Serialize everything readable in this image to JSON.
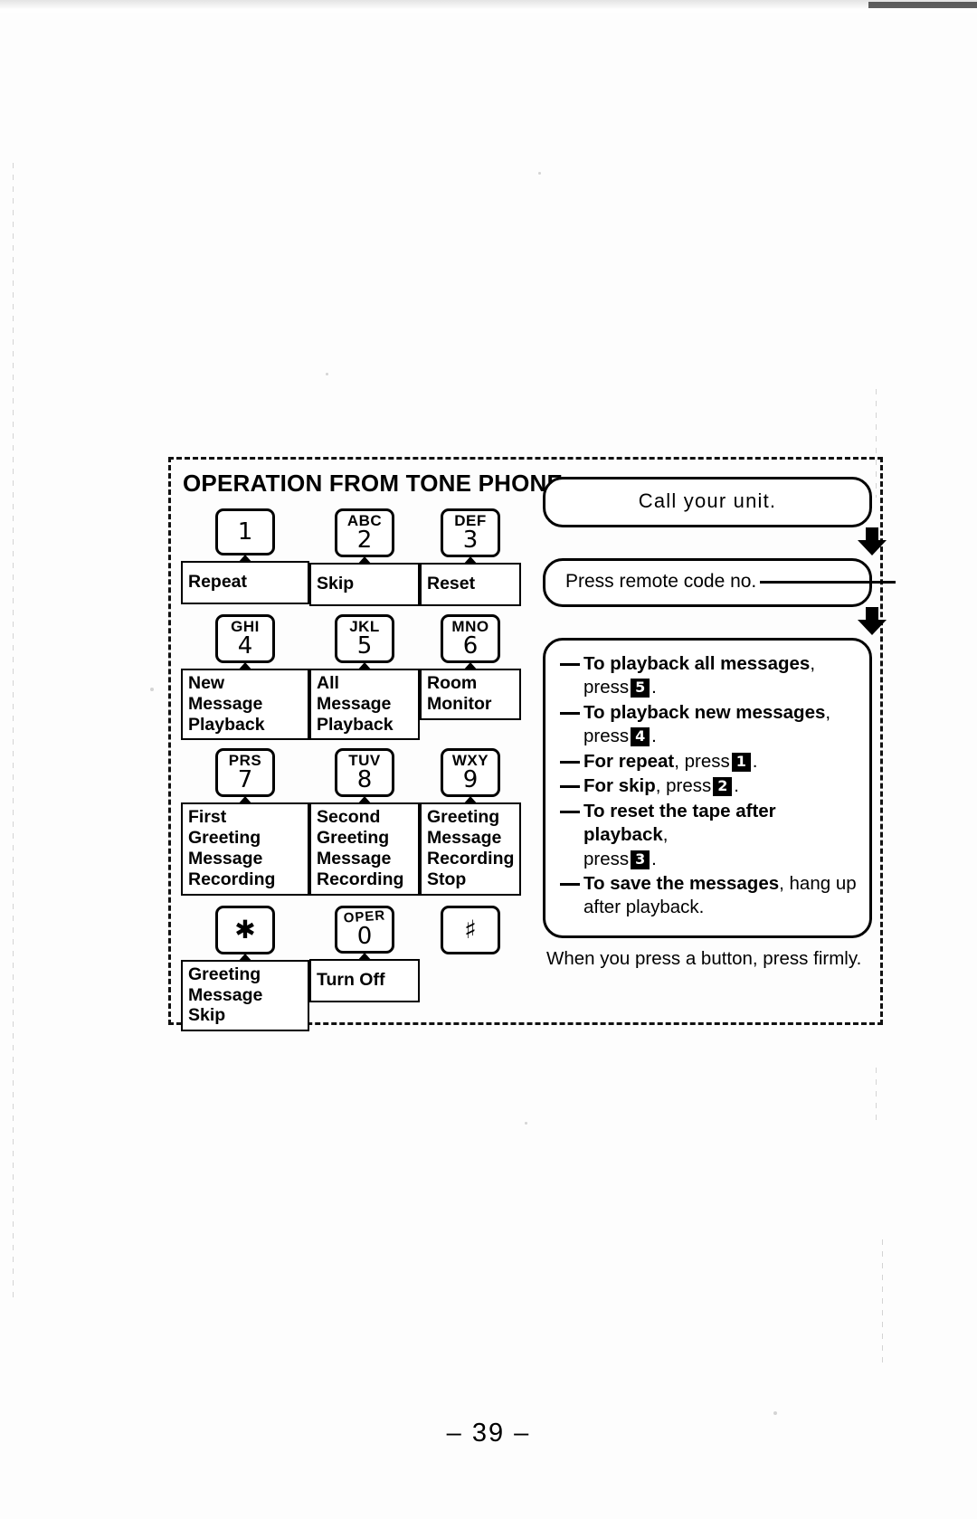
{
  "section": {
    "title": "OPERATION FROM TONE PHONE"
  },
  "keypad": {
    "rows": [
      [
        {
          "letters": "",
          "digit": "1",
          "label": "Repeat"
        },
        {
          "letters": "ABC",
          "digit": "2",
          "label": "Skip"
        },
        {
          "letters": "DEF",
          "digit": "3",
          "label": "Reset"
        }
      ],
      [
        {
          "letters": "GHI",
          "digit": "4",
          "label": "New Message\nPlayback"
        },
        {
          "letters": "JKL",
          "digit": "5",
          "label": "All Message\nPlayback"
        },
        {
          "letters": "MNO",
          "digit": "6",
          "label": "Room\nMonitor"
        }
      ],
      [
        {
          "letters": "PRS",
          "digit": "7",
          "label": "First\nGreeting\nMessage\nRecording"
        },
        {
          "letters": "TUV",
          "digit": "8",
          "label": "Second\nGreeting\nMessage\nRecording"
        },
        {
          "letters": "WXY",
          "digit": "9",
          "label": "Greeting\nMessage\nRecording\nStop"
        }
      ]
    ],
    "bottom_row": [
      {
        "letters": "",
        "glyph": "✱",
        "label": "Greeting\nMessage Skip"
      },
      {
        "letters": "OPER",
        "digit": "0",
        "label": "Turn Off"
      },
      {
        "letters": "",
        "glyph": "♯",
        "label": ""
      }
    ],
    "labels": {
      "key1": "Repeat",
      "key2": "Skip",
      "key3": "Reset",
      "key4": "New Message Playback",
      "key5": "All Message Playback",
      "key6": "Room Monitor",
      "key7": "First Greeting Message Recording",
      "key8": "Second Greeting Message Recording",
      "key9": "Greeting Message Recording Stop",
      "keystar": "Greeting Message Skip",
      "key0": "Turn Off"
    }
  },
  "flow": {
    "step1": "Call your unit.",
    "step2_text": "Press remote code no.",
    "instructions": [
      {
        "bold": "To playback all messages",
        "tail": ",",
        "line2_prefix": "press",
        "key": "5",
        "line2_suffix": "."
      },
      {
        "bold": "To playback new messages",
        "tail": ",",
        "line2_prefix": "press",
        "key": "4",
        "line2_suffix": "."
      },
      {
        "bold": "For repeat",
        "tail": ",",
        "inline_prefix": "press",
        "key": "1",
        "inline_suffix": "."
      },
      {
        "bold": "For skip",
        "tail": ",",
        "inline_prefix": "press",
        "key": "2",
        "inline_suffix": "."
      },
      {
        "bold": "To reset the tape after playback",
        "tail": ",",
        "line2_prefix": "press",
        "key": "3",
        "line2_suffix": "."
      },
      {
        "bold": "To save the messages",
        "tail": ",",
        "inline_tail_text": "hang up",
        "line2_text": "after playback."
      }
    ],
    "footnote": "When you press a button, press firmly."
  },
  "page": {
    "number": "– 39 –"
  }
}
